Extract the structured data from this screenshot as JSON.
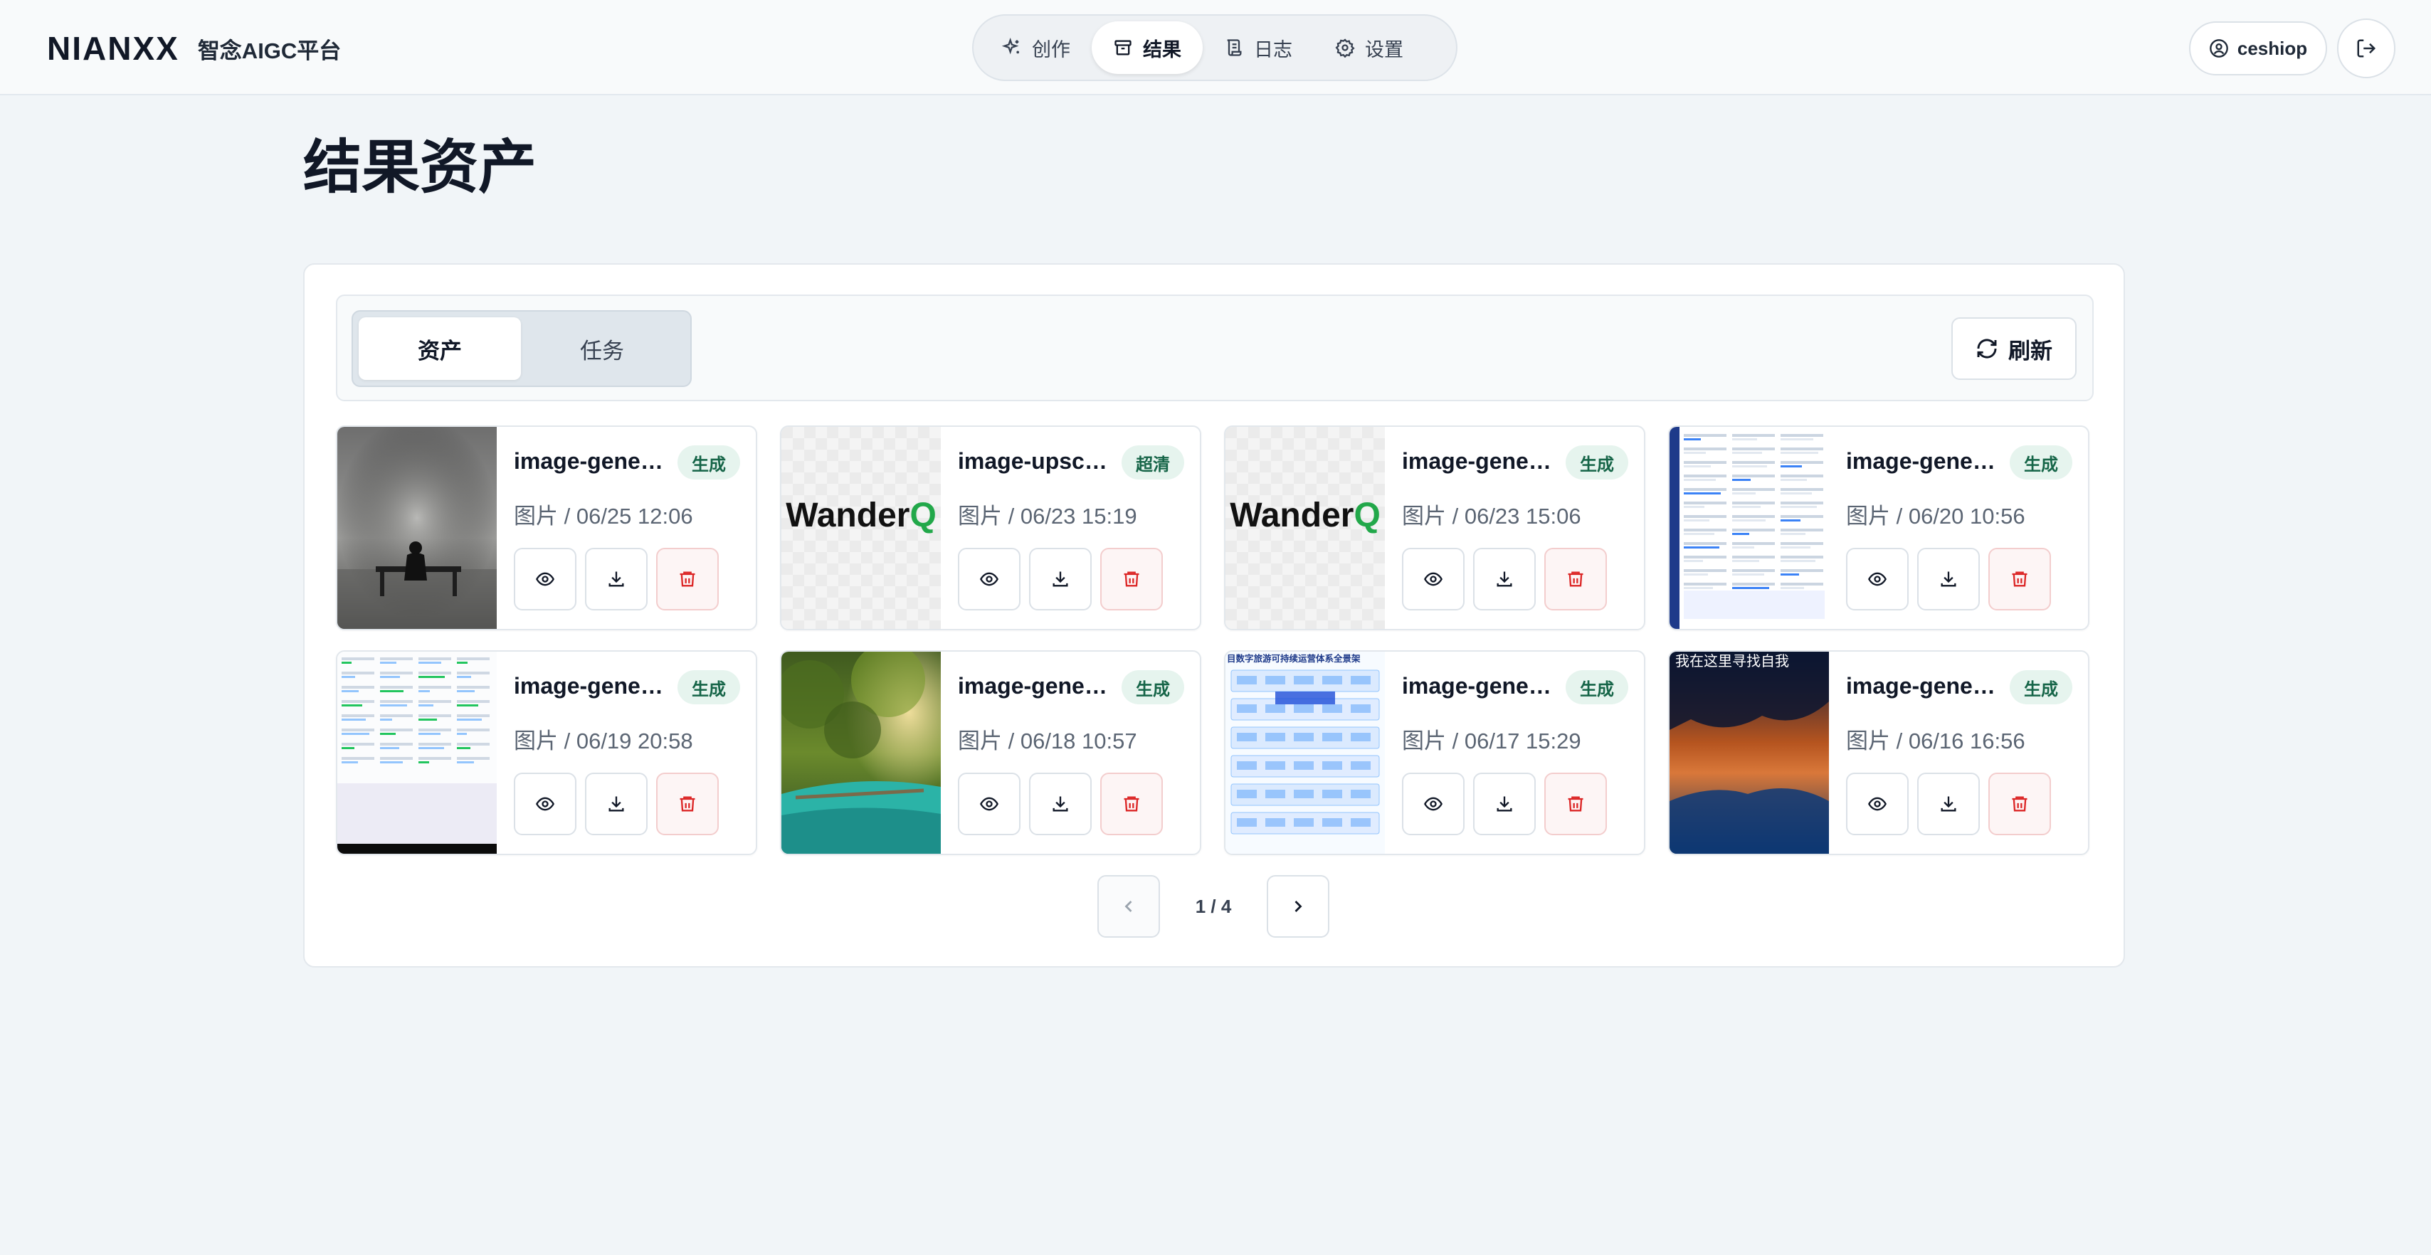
{
  "header": {
    "logo": "NIANXX",
    "platform": "智念AIGC平台",
    "nav": [
      {
        "label": "创作",
        "icon": "sparkles-icon",
        "active": false
      },
      {
        "label": "结果",
        "icon": "archive-icon",
        "active": true
      },
      {
        "label": "日志",
        "icon": "scroll-icon",
        "active": false
      },
      {
        "label": "设置",
        "icon": "gear-icon",
        "active": false
      }
    ],
    "user": "ceshiop"
  },
  "page": {
    "title": "结果资产"
  },
  "tabs": [
    {
      "label": "资产",
      "active": true
    },
    {
      "label": "任务",
      "active": false
    }
  ],
  "refresh_label": "刷新",
  "cards": [
    {
      "title": "image-generation",
      "badge": "生成",
      "meta": "图片 / 06/25 12:06",
      "thumb": "dark-room-figure"
    },
    {
      "title": "image-upscale",
      "badge": "超清",
      "meta": "图片 / 06/23 15:19",
      "thumb": "wanderq-logo"
    },
    {
      "title": "image-generation",
      "badge": "生成",
      "meta": "图片 / 06/23 15:06",
      "thumb": "wanderq-logo"
    },
    {
      "title": "image-generation",
      "badge": "生成",
      "meta": "图片 / 06/20 10:56",
      "thumb": "dashboard-screenshot"
    },
    {
      "title": "image-generation",
      "badge": "生成",
      "meta": "图片 / 06/19 20:58",
      "thumb": "dashboard-light"
    },
    {
      "title": "image-generation",
      "badge": "生成",
      "meta": "图片 / 06/18 10:57",
      "thumb": "river-forest"
    },
    {
      "title": "image-generation",
      "badge": "生成",
      "meta": "图片 / 06/17 15:29",
      "thumb": "system-diagram"
    },
    {
      "title": "image-generation",
      "badge": "生成",
      "meta": "图片 / 06/16 16:56",
      "thumb": "cave-reflection"
    }
  ],
  "thumb_text": {
    "wanderq": "WanderQ",
    "diagram_title": "目数字旅游可持续运营体系全景架",
    "cave_caption": "我在这里寻找自我"
  },
  "pagination": {
    "label": "1 / 4"
  },
  "colors": {
    "badge_bg": "#e6f4ee",
    "badge_text": "#166548",
    "danger": "#dc2626",
    "wanderq_green": "#22a84a"
  }
}
